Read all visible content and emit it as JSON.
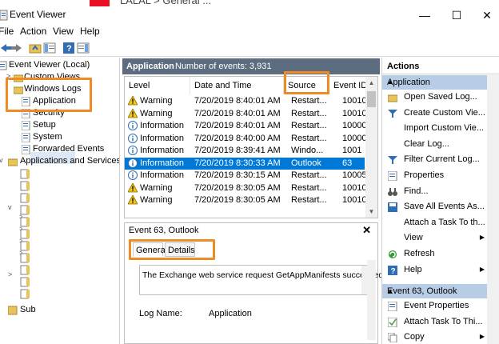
{
  "background_window": {
    "breadcrumb": "LALAL > General ..."
  },
  "window": {
    "title": "Event Viewer",
    "minimize": "—",
    "maximize": "☐",
    "close": "✕"
  },
  "menu": [
    "File",
    "Action",
    "View",
    "Help"
  ],
  "tree": {
    "root": "Event Viewer (Local)",
    "custom_views": "Custom Views",
    "windows_logs": "Windows Logs",
    "logs": [
      "Application",
      "Security",
      "Setup",
      "System",
      "Forwarded Events"
    ],
    "apps_services": "Applications and Services Lo",
    "subscriptions": "Sub"
  },
  "center": {
    "header_title": "Application",
    "header_count": "Number of events: 3,931",
    "columns": [
      "Level",
      "Date and Time",
      "Source",
      "Event ID"
    ],
    "rows": [
      {
        "level": "Warning",
        "date": "7/20/2019 8:40:01 AM",
        "source": "Restart...",
        "id": "10010",
        "type": "warning"
      },
      {
        "level": "Warning",
        "date": "7/20/2019 8:40:01 AM",
        "source": "Restart...",
        "id": "10010",
        "type": "warning"
      },
      {
        "level": "Information",
        "date": "7/20/2019 8:40:01 AM",
        "source": "Restart...",
        "id": "10000",
        "type": "info"
      },
      {
        "level": "Information",
        "date": "7/20/2019 8:40:00 AM",
        "source": "Restart...",
        "id": "10000",
        "type": "info"
      },
      {
        "level": "Information",
        "date": "7/20/2019 8:39:41 AM",
        "source": "Windo...",
        "id": "1001",
        "type": "info"
      },
      {
        "level": "Information",
        "date": "7/20/2019 8:30:33 AM",
        "source": "Outlook",
        "id": "63",
        "type": "info"
      },
      {
        "level": "Information",
        "date": "7/20/2019 8:30:15 AM",
        "source": "Restart...",
        "id": "10005",
        "type": "info"
      },
      {
        "level": "Warning",
        "date": "7/20/2019 8:30:05 AM",
        "source": "Restart...",
        "id": "10010",
        "type": "warning"
      },
      {
        "level": "Warning",
        "date": "7/20/2019 8:30:05 AM",
        "source": "Restart...",
        "id": "10010",
        "type": "warning"
      }
    ],
    "detail": {
      "title": "Event 63, Outlook",
      "close": "✕",
      "tabs": [
        "General",
        "Details"
      ],
      "message": "The Exchange web service request GetAppManifests succeeded.",
      "log_name_label": "Log Name:",
      "log_name_value": "Application"
    }
  },
  "actions": {
    "header": "Actions",
    "section1": "Application",
    "items1": [
      {
        "label": "Open Saved Log...",
        "icon": "folder-icon"
      },
      {
        "label": "Create Custom Vie...",
        "icon": "filter-icon"
      },
      {
        "label": "Import Custom Vie...",
        "icon": "blank"
      },
      {
        "label": "Clear Log...",
        "icon": "blank"
      },
      {
        "label": "Filter Current Log...",
        "icon": "filter-icon"
      },
      {
        "label": "Properties",
        "icon": "properties-icon"
      },
      {
        "label": "Find...",
        "icon": "binoculars-icon"
      },
      {
        "label": "Save All Events As...",
        "icon": "save-icon"
      },
      {
        "label": "Attach a Task To th...",
        "icon": "blank"
      },
      {
        "label": "View",
        "icon": "blank",
        "submenu": true
      },
      {
        "label": "Refresh",
        "icon": "refresh-icon"
      },
      {
        "label": "Help",
        "icon": "help-icon",
        "submenu": true
      }
    ],
    "section2": "Event 63, Outlook",
    "items2": [
      {
        "label": "Event Properties",
        "icon": "properties-icon"
      },
      {
        "label": "Attach Task To Thi...",
        "icon": "task-icon"
      },
      {
        "label": "Copy",
        "icon": "copy-icon",
        "submenu": true
      }
    ]
  },
  "colors": {
    "accent": "#0078d7",
    "header_bar": "#5c6d80",
    "annotation": "#f08a24",
    "section_blue": "#b7cde5"
  }
}
